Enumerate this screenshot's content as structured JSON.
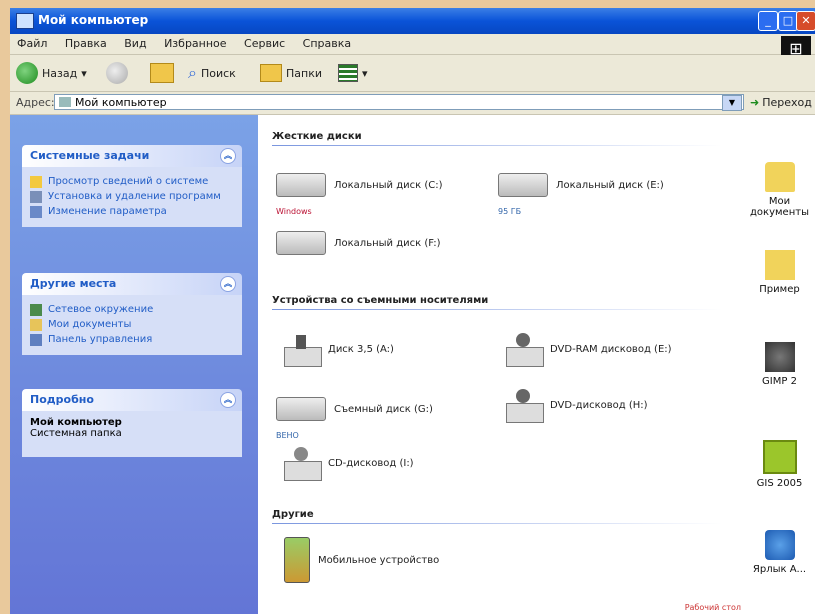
{
  "window": {
    "title": "Мой компьютер",
    "close_label": "✕",
    "max_label": "□",
    "min_label": "_"
  },
  "menu": [
    "Файл",
    "Правка",
    "Вид",
    "Избранное",
    "Сервис",
    "Справка"
  ],
  "toolbar": {
    "back": "Назад",
    "search": "Поиск",
    "folders": "Папки"
  },
  "address": {
    "label": "Адрес:",
    "value": "Мой компьютер",
    "go": "Переход"
  },
  "left_panel": {
    "system_tasks": {
      "title": "Системные задачи",
      "items": [
        "Просмотр сведений о системе",
        "Установка и удаление программ",
        "Изменение параметра"
      ]
    },
    "other_places": {
      "title": "Другие места",
      "items": [
        "Сетевое окружение",
        "Мои документы",
        "Панель управления"
      ]
    },
    "details": {
      "title": "Подробно",
      "name": "Мой компьютер",
      "type": "Системная папка"
    }
  },
  "main": {
    "groups": {
      "hdd": "Жесткие диски",
      "removable": "Устройства со съемными носителями",
      "other": "Другие"
    },
    "hdds": [
      {
        "label": "Локальный диск (C:)",
        "sub": "Windows"
      },
      {
        "label": "Локальный диск (E:)",
        "sub": "95 ГБ"
      },
      {
        "label": "Локальный диск (F:)",
        "sub": ""
      }
    ],
    "removable": [
      {
        "label": "Диск 3,5 (A:)",
        "sub": ""
      },
      {
        "label": "DVD-RAM дисковод (E:)",
        "sub": ""
      },
      {
        "label": "Съемный диск (G:)",
        "sub": "ВЕНО"
      },
      {
        "label": "DVD-дисковод (H:)",
        "sub": ""
      },
      {
        "label": "CD-дисковод (I:)",
        "sub": ""
      }
    ],
    "other_items": [
      {
        "label": "Мобильное устройство"
      }
    ]
  },
  "desktop": {
    "icons": [
      {
        "label": "Мои документы"
      },
      {
        "label": "Пример"
      },
      {
        "label": "GIMP 2"
      },
      {
        "label": "GIS 2005"
      },
      {
        "label": "Ярлык А..."
      }
    ]
  },
  "corner_text": "Рабочий стол"
}
